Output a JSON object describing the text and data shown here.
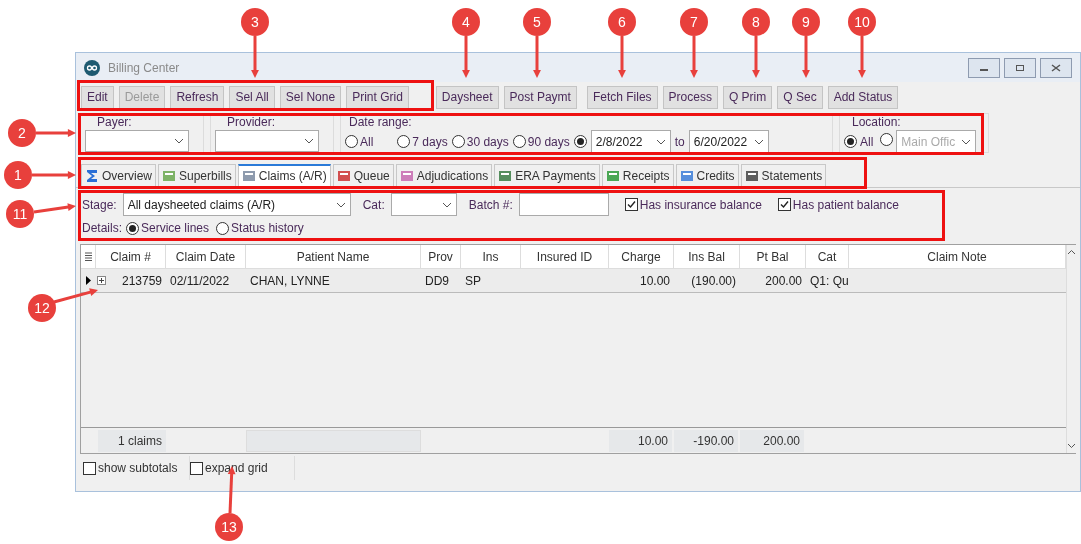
{
  "callouts": [
    {
      "number": "3"
    },
    {
      "number": "4"
    },
    {
      "number": "5"
    },
    {
      "number": "6"
    },
    {
      "number": "7"
    },
    {
      "number": "8"
    },
    {
      "number": "9"
    },
    {
      "number": "10"
    },
    {
      "number": "2"
    },
    {
      "number": "1"
    },
    {
      "number": "11"
    },
    {
      "number": "12"
    },
    {
      "number": "13"
    }
  ],
  "window": {
    "title": "Billing Center"
  },
  "toolbar": [
    {
      "label": "Edit",
      "disabled": false
    },
    {
      "label": "Delete",
      "disabled": true
    },
    {
      "label": "Refresh",
      "disabled": false
    },
    {
      "label": "Sel All",
      "disabled": false
    },
    {
      "label": "Sel None",
      "disabled": false
    },
    {
      "label": "Print Grid",
      "disabled": false
    },
    {
      "label": "Daysheet",
      "disabled": false
    },
    {
      "label": "Post Paymt",
      "disabled": false
    },
    {
      "label": "Fetch Files",
      "disabled": false
    },
    {
      "label": "Process",
      "disabled": false
    },
    {
      "label": "Q Prim",
      "disabled": false
    },
    {
      "label": "Q Sec",
      "disabled": false
    },
    {
      "label": "Add Status",
      "disabled": false
    }
  ],
  "filters": {
    "payer": {
      "label": "Payer:"
    },
    "provider": {
      "label": "Provider:"
    },
    "date_range": {
      "label": "Date range:",
      "options": [
        {
          "label": "All",
          "selected": false
        },
        {
          "label": "7 days",
          "selected": false
        },
        {
          "label": "30 days",
          "selected": false
        },
        {
          "label": "90 days",
          "selected": false
        }
      ],
      "custom_selected": true,
      "from": "2/8/2022",
      "to_label": "to",
      "to": "6/20/2022"
    },
    "location": {
      "label": "Location:",
      "all": {
        "label": "All",
        "selected": true
      },
      "other": {
        "selected": false,
        "value": "Main Offic"
      }
    }
  },
  "tabs": [
    {
      "label": "Overview",
      "selected": false
    },
    {
      "label": "Superbills",
      "selected": false
    },
    {
      "label": "Claims (A/R)",
      "selected": true
    },
    {
      "label": "Queue",
      "selected": false
    },
    {
      "label": "Adjudications",
      "selected": false
    },
    {
      "label": "ERA Payments",
      "selected": false
    },
    {
      "label": "Receipts",
      "selected": false
    },
    {
      "label": "Credits",
      "selected": false
    },
    {
      "label": "Statements",
      "selected": false
    }
  ],
  "claims_filter": {
    "stage_label": "Stage:",
    "stage": "All daysheeted claims (A/R)",
    "cat_label": "Cat:",
    "batch_label": "Batch #:",
    "checkboxes": [
      {
        "label": "Has insurance balance",
        "checked": true
      },
      {
        "label": "Has patient balance",
        "checked": true
      }
    ],
    "details_label": "Details:",
    "details": [
      {
        "label": "Service lines",
        "selected": true
      },
      {
        "label": "Status history",
        "selected": false
      }
    ]
  },
  "table": {
    "columns": [
      "Claim #",
      "Claim Date",
      "Patient Name",
      "Prov",
      "Ins",
      "Insured ID",
      "Charge",
      "Ins Bal",
      "Pt Bal",
      "Cat",
      "Claim Note"
    ],
    "rows": [
      {
        "selected": true,
        "cells": [
          "213759",
          "02/11/2022",
          "CHAN, LYNNE",
          "DD9",
          "SP",
          "",
          "10.00",
          "(190.00)",
          "200.00",
          "Q1: Qu",
          ""
        ]
      }
    ],
    "totals": {
      "count": "1 claims",
      "charge": "10.00",
      "ins_bal": "-190.00",
      "pt_bal": "200.00"
    }
  },
  "footer": [
    {
      "label": "show subtotals",
      "checked": false
    },
    {
      "label": "expand grid",
      "checked": false
    }
  ]
}
